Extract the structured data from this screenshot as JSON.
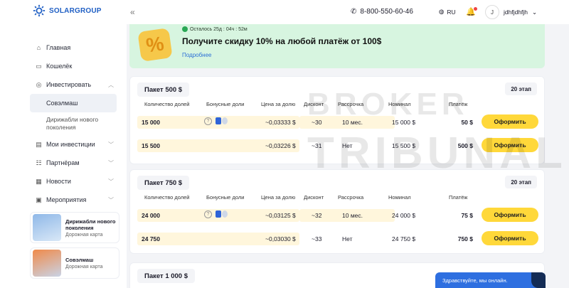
{
  "brand": {
    "name": "SOLARGROUP"
  },
  "sidebar": {
    "items": [
      {
        "label": "Главная",
        "icon": "home-icon"
      },
      {
        "label": "Кошелёк",
        "icon": "wallet-icon"
      },
      {
        "label": "Инвестировать",
        "icon": "invest-icon"
      },
      {
        "label": "Мои инвестиции",
        "icon": "portfolio-icon"
      },
      {
        "label": "Партнёрам",
        "icon": "partners-icon"
      },
      {
        "label": "Новости",
        "icon": "news-icon"
      },
      {
        "label": "Мероприятия",
        "icon": "calendar-icon"
      }
    ],
    "sub_items": [
      {
        "label": "Совэлмаш"
      },
      {
        "label": "Дирижабли нового поколения"
      }
    ],
    "promos": [
      {
        "title": "Дирижабли нового поколения",
        "subtitle": "Дорожная карта"
      },
      {
        "title": "Совэлмаш",
        "subtitle": "Дорожная карта"
      }
    ]
  },
  "header": {
    "phone": "8-800-550-60-46",
    "lang": "RU",
    "avatar_initial": "J",
    "username": "jdhfjdhfjh"
  },
  "banner": {
    "timer": "Осталось 25д : 04ч : 52м",
    "headline": "Получите скидку 10% на любой платёж от 100$",
    "more": "Подробнее",
    "badge": "%"
  },
  "columns": [
    "Количество долей",
    "Бонусные доли",
    "Цена за долю",
    "Дисконт",
    "Рассрочка",
    "Номинал",
    "Платёж"
  ],
  "packages": [
    {
      "title": "Пакет 500 $",
      "stage": "20 этап",
      "rows": [
        {
          "qty": "15 000",
          "price": "~0,03333 $",
          "discount": "~30",
          "installment": "10 мес.",
          "nominal": "15 000 $",
          "payment": "50 $",
          "bonus": true
        },
        {
          "qty": "15 500",
          "price": "~0,03226 $",
          "discount": "~31",
          "installment": "Нет",
          "nominal": "15 500 $",
          "payment": "500 $",
          "bonus": false
        }
      ]
    },
    {
      "title": "Пакет 750 $",
      "stage": "20 этап",
      "rows": [
        {
          "qty": "24 000",
          "price": "~0,03125 $",
          "discount": "~32",
          "installment": "10 мес.",
          "nominal": "24 000 $",
          "payment": "75 $",
          "bonus": true
        },
        {
          "qty": "24 750",
          "price": "~0,03030 $",
          "discount": "~33",
          "installment": "Нет",
          "nominal": "24 750 $",
          "payment": "750 $",
          "bonus": false
        }
      ]
    },
    {
      "title": "Пакет 1 000 $"
    }
  ],
  "button_label": "Оформить",
  "chat": {
    "text": "Здравствуйте, мы онлайн."
  },
  "watermark": {
    "line1": "BROKER",
    "line2": "TRIBUNAL"
  }
}
